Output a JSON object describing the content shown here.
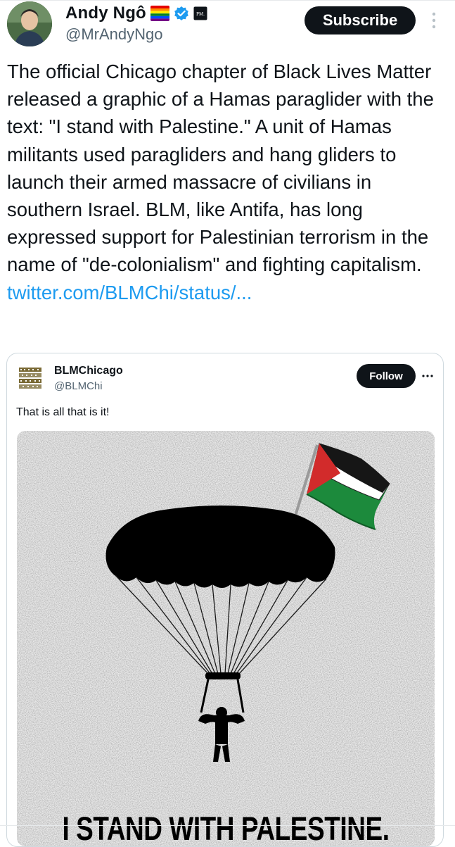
{
  "author": {
    "display_name": "Andy Ngô",
    "handle": "@MrAndyNgo",
    "badge_icons": [
      "rainbow-flag-icon",
      "verified-badge-icon",
      "affiliate-badge-icon"
    ],
    "affiliate_badge_text": "PM."
  },
  "actions": {
    "subscribe_label": "Subscribe",
    "more_icon": "more-vertical-icon"
  },
  "tweet": {
    "text": "The official Chicago chapter of Black Lives Matter released a graphic of a Hamas paraglider with the text: \"I stand with Palestine.\" A unit of Hamas militants used paragliders and hang gliders to launch their armed massacre of civilians in southern Israel. BLM, like Antifa, has long expressed support for Palestinian terrorism in the name of \"de-colonialism\" and fighting capitalism.",
    "link": "twitter.com/BLMChi/status/..."
  },
  "quoted_tweet": {
    "display_name": "BLMChicago",
    "handle": "@BLMChi",
    "avatar_text": "BLACK LIVES MATTER CHICAGO",
    "follow_label": "Follow",
    "more_icon": "more-horizontal-icon",
    "text": "That is all that is it!",
    "poster_caption": "I STAND WITH PALESTINE."
  },
  "colors": {
    "link": "#1d9bf0",
    "button_bg": "#0f1419",
    "secondary_text": "#536471",
    "verified": "#1d9bf0",
    "flag_red": "#d22b2b",
    "flag_green": "#1c8a3c"
  }
}
